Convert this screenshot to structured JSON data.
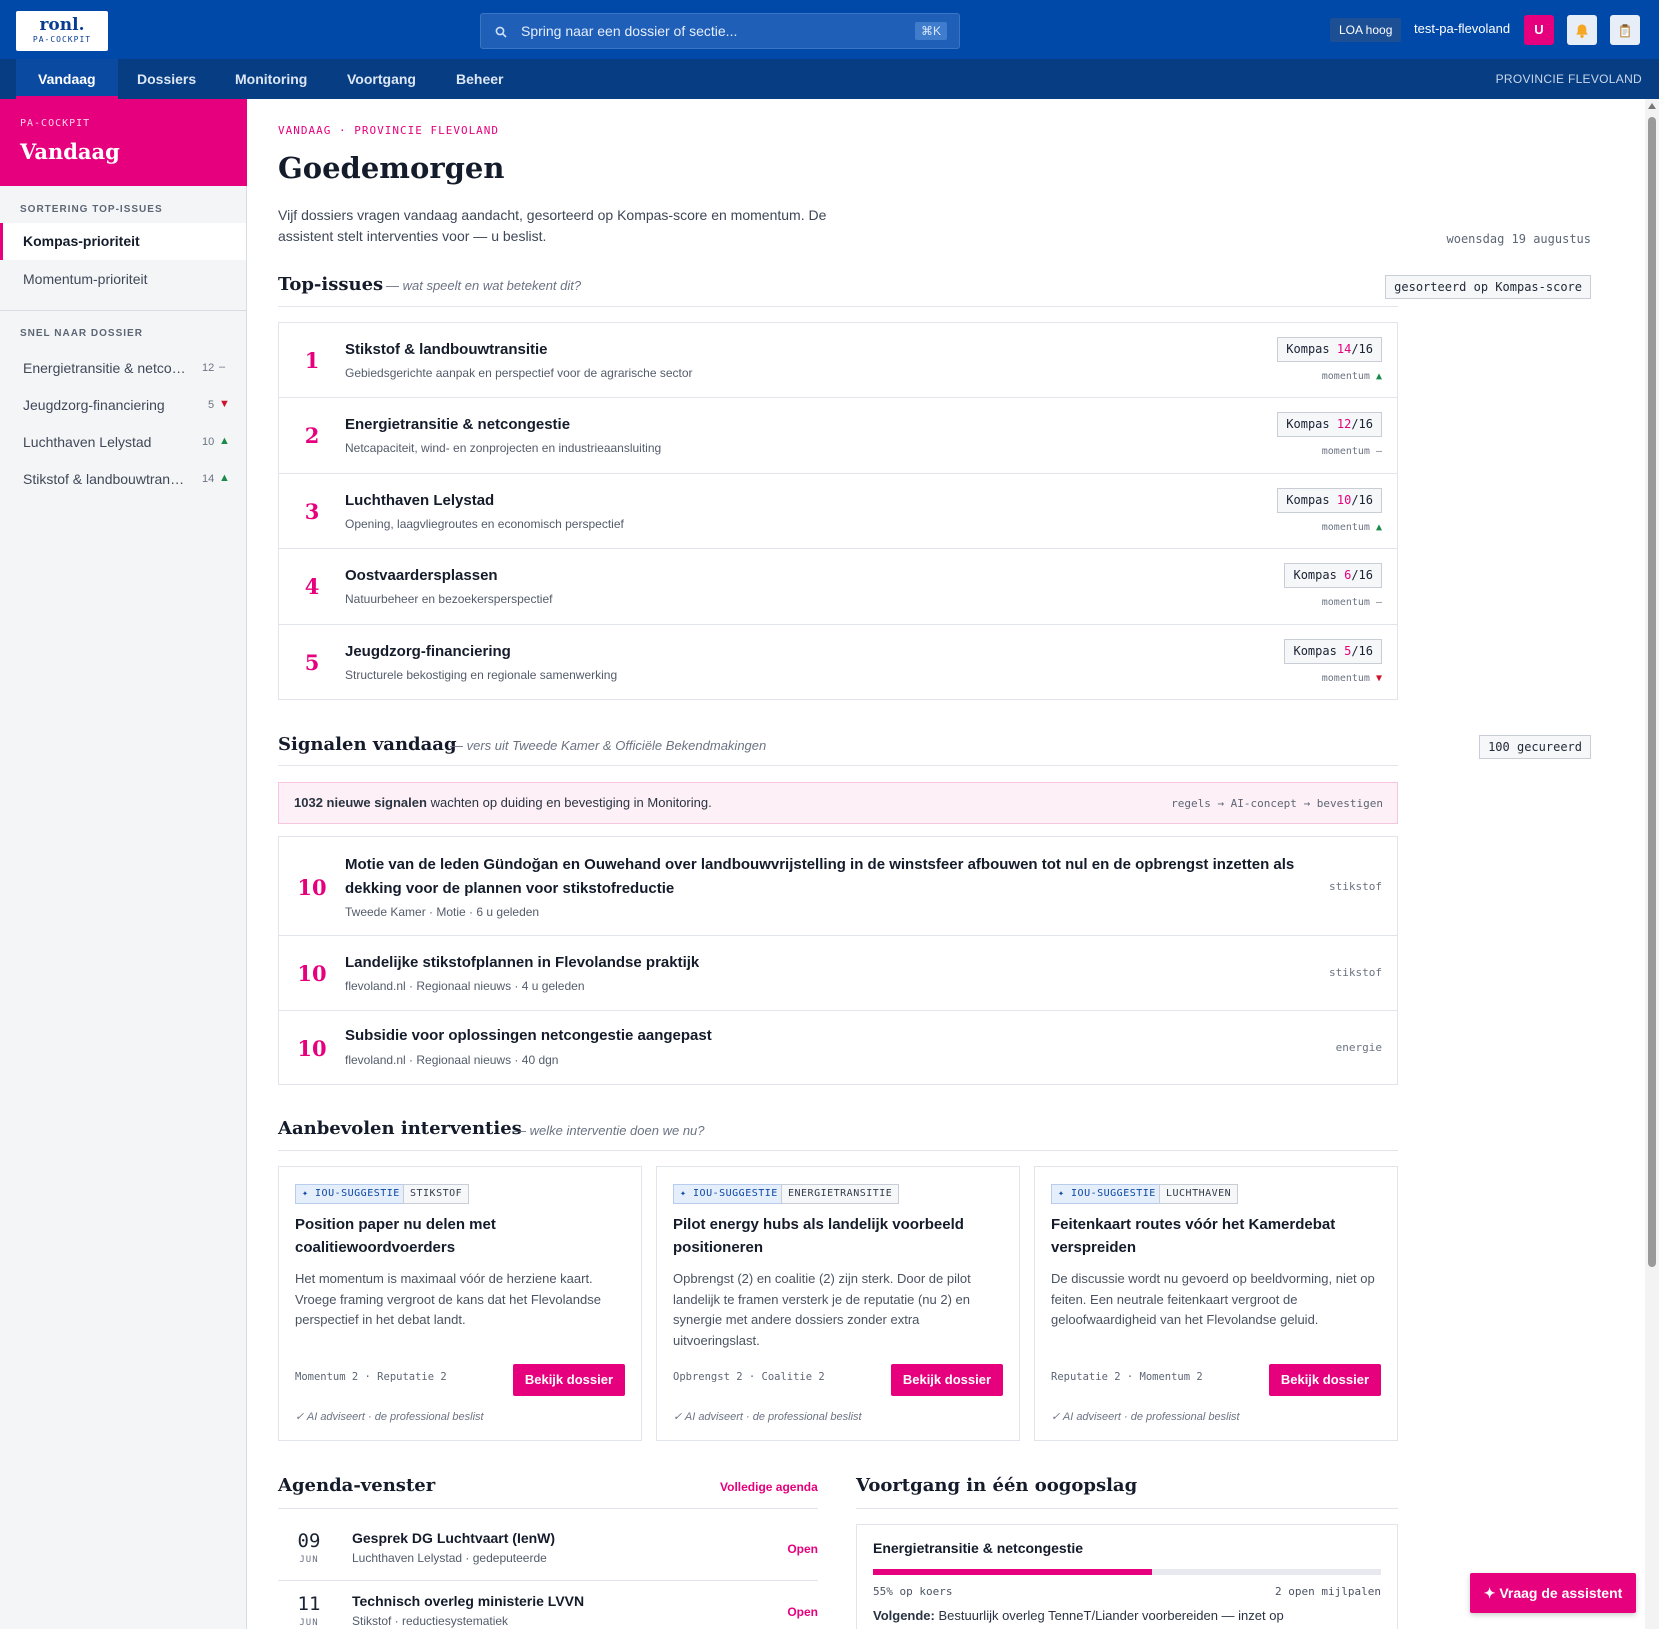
{
  "header": {
    "logo_main": "ronl.",
    "logo_sub": "PA-COCKPIT",
    "search_placeholder": "Spring naar een dossier of sectie...",
    "search_shortcut": "⌘K",
    "loa_badge": "LOA hoog",
    "username": "test-pa-flevoland",
    "avatar_initial": "U",
    "icons": [
      "search-icon",
      "bell-icon",
      "clipboard-icon"
    ]
  },
  "nav": {
    "items": [
      "Vandaag",
      "Dossiers",
      "Monitoring",
      "Voortgang",
      "Beheer"
    ],
    "active": "Vandaag",
    "province": "PROVINCIE FLEVOLAND"
  },
  "sidebar": {
    "kicker": "PA-COCKPIT",
    "title": "Vandaag",
    "sort_heading": "SORTERING TOP-ISSUES",
    "sort_options": [
      "Kompas-prioriteit",
      "Momentum-prioriteit"
    ],
    "quick_heading": "SNEL NAAR DOSSIER",
    "quick_items": [
      {
        "name": "Energietransitie & netcongestie",
        "score": "12",
        "trend": "–"
      },
      {
        "name": "Jeugdzorg-financiering",
        "score": "5",
        "trend": "▼"
      },
      {
        "name": "Luchthaven Lelystad",
        "score": "10",
        "trend": "▲"
      },
      {
        "name": "Stikstof & landbouwtransitie",
        "score": "14",
        "trend": "▲"
      }
    ]
  },
  "main": {
    "eyebrow": "VANDAAG · PROVINCIE FLEVOLAND",
    "greeting": "Goedemorgen",
    "intro": "Vijf dossiers vragen vandaag aandacht, gesorteerd op Kompas-score en momentum. De assistent stelt interventies voor — u beslist.",
    "date": "woensdag 19 augustus",
    "top_issues": {
      "title": "Top-issues",
      "subtitle": "— wat speelt en wat betekent dit?",
      "sort_tag": "gesorteerd op Kompas-score",
      "kompas_label": "Kompas",
      "momentum_label": "momentum",
      "items": [
        {
          "rank": "1",
          "title": "Stikstof & landbouwtransitie",
          "sub": "Gebiedsgerichte aanpak en perspectief voor de agrarische sector",
          "score": "14",
          "max": "/16",
          "trend": "▲"
        },
        {
          "rank": "2",
          "title": "Energietransitie & netcongestie",
          "sub": "Netcapaciteit, wind- en zonprojecten en industrieaansluiting",
          "score": "12",
          "max": "/16",
          "trend": "–"
        },
        {
          "rank": "3",
          "title": "Luchthaven Lelystad",
          "sub": "Opening, laagvliegroutes en economisch perspectief",
          "score": "10",
          "max": "/16",
          "trend": "▲"
        },
        {
          "rank": "4",
          "title": "Oostvaardersplassen",
          "sub": "Natuurbeheer en bezoekersperspectief",
          "score": "6",
          "max": "/16",
          "trend": "–"
        },
        {
          "rank": "5",
          "title": "Jeugdzorg-financiering",
          "sub": "Structurele bekostiging en regionale samenwerking",
          "score": "5",
          "max": "/16",
          "trend": "▼"
        }
      ]
    },
    "signals": {
      "title": "Signalen vandaag",
      "subtitle": "— vers uit Tweede Kamer & Officiële Bekendmakingen",
      "curated_tag": "100 gecureerd",
      "alert_count": "1032 nieuwe signalen",
      "alert_text": "wachten op duiding en bevestiging in Monitoring.",
      "pipeline": "regels → AI-concept → bevestigen",
      "items": [
        {
          "score": "10",
          "title": "Motie van de leden Gündoğan en Ouwehand over landbouwvrijstelling in de winstsfeer afbouwen tot nul en de opbrengst inzetten als dekking voor de plannen voor stikstofreductie",
          "meta": "Tweede Kamer · Motie · 6 u geleden",
          "tag": "stikstof"
        },
        {
          "score": "10",
          "title": "Landelijke stikstofplannen in Flevolandse praktijk",
          "meta": "flevoland.nl · Regionaal nieuws · 4 u geleden",
          "tag": "stikstof"
        },
        {
          "score": "10",
          "title": "Subsidie voor oplossingen netcongestie aangepast",
          "meta": "flevoland.nl · Regionaal nieuws · 40 dgn",
          "tag": "energie"
        }
      ]
    },
    "interventions": {
      "title": "Aanbevolen interventies",
      "subtitle": "— welke interventie doen we nu?",
      "ai_chip": "✦ IOU-SUGGESTIE",
      "button": "Bekijk dossier",
      "footer": "✓ AI adviseert · de professional beslist",
      "cards": [
        {
          "category": "STIKSTOF",
          "title": "Position paper nu delen met coalitiewoordvoerders",
          "body": "Het momentum is maximaal vóór de herziene kaart. Vroege framing vergroot de kans dat het Flevolandse perspectief in het debat landt.",
          "metrics": "Momentum 2 · Reputatie 2"
        },
        {
          "category": "ENERGIETRANSITIE",
          "title": "Pilot energy hubs als landelijk voorbeeld positioneren",
          "body": "Opbrengst (2) en coalitie (2) zijn sterk. Door de pilot landelijk te framen versterk je de reputatie (nu 2) en synergie met andere dossiers zonder extra uitvoeringslast.",
          "metrics": "Opbrengst 2 · Coalitie 2"
        },
        {
          "category": "LUCHTHAVEN",
          "title": "Feitenkaart routes vóór het Kamerdebat verspreiden",
          "body": "De discussie wordt nu gevoerd op beeldvorming, niet op feiten. Een neutrale feitenkaart vergroot de geloofwaardigheid van het Flevolandse geluid.",
          "metrics": "Reputatie 2 · Momentum 2"
        }
      ]
    },
    "agenda": {
      "title": "Agenda-venster",
      "link": "Volledige agenda",
      "open_label": "Open",
      "items": [
        {
          "day": "09",
          "month": "JUN",
          "title": "Gesprek DG Luchtvaart (IenW)",
          "sub": "Luchthaven Lelystad · gedeputeerde"
        },
        {
          "day": "11",
          "month": "JUN",
          "title": "Technisch overleg ministerie LVVN",
          "sub": "Stikstof · reductiesystematiek"
        }
      ]
    },
    "progress": {
      "title": "Voortgang in één oogopslag",
      "dossier": "Energietransitie & netcongestie",
      "percent": 55,
      "percent_label": "55% op koers",
      "milestones": "2 open mijlpalen",
      "next_label": "Volgende:",
      "next_text": "Bestuurlijk overleg TenneT/Liander voorbereiden — inzet op"
    },
    "assistant_button": "Vraag de assistent"
  }
}
